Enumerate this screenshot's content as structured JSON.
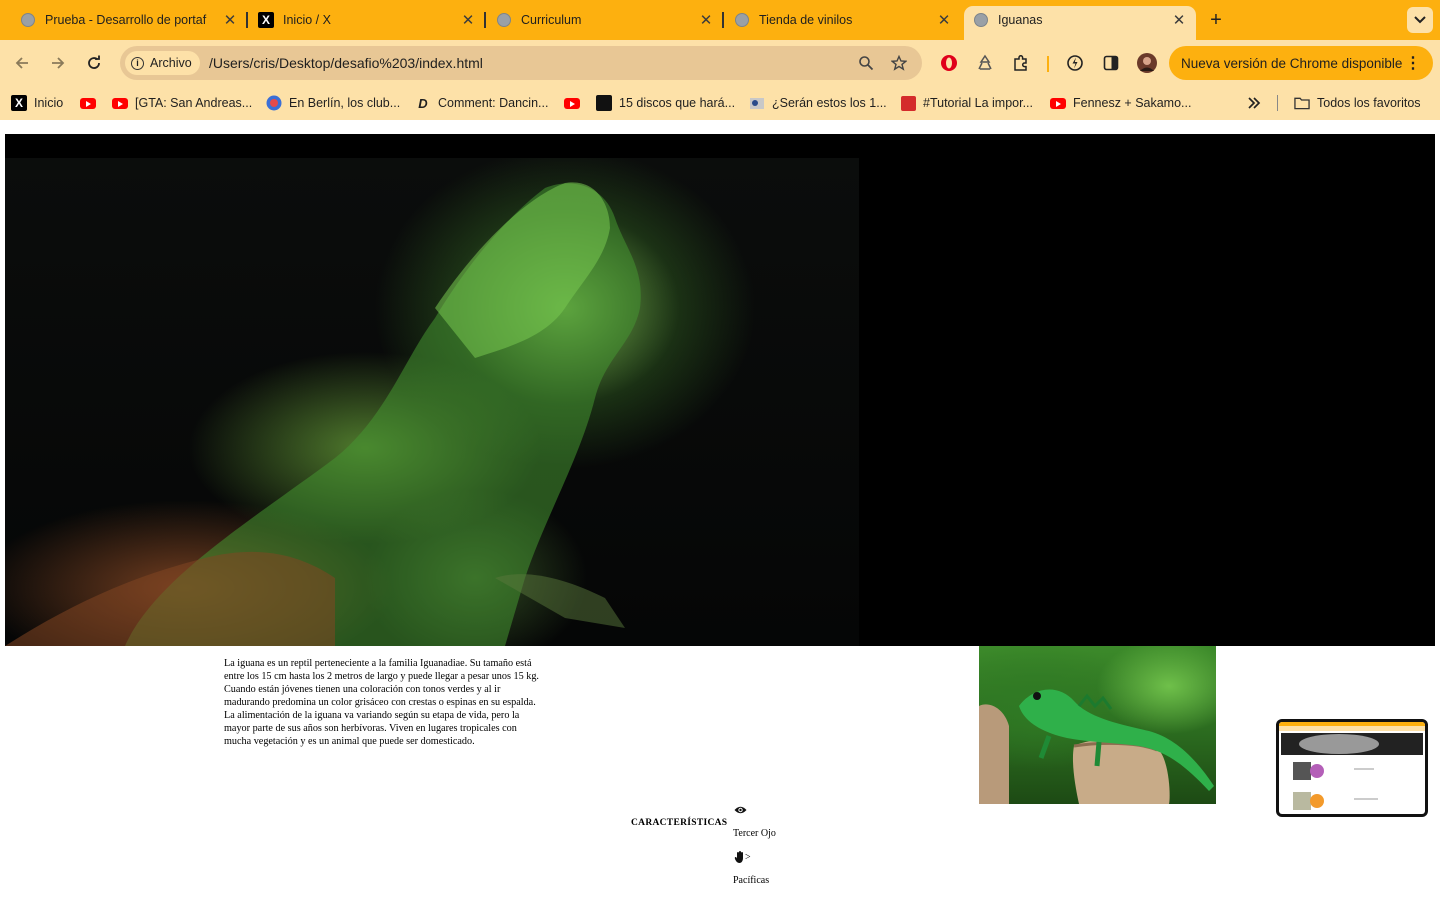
{
  "browser": {
    "tabs": [
      {
        "title": "Prueba - Desarrollo de portaf",
        "icon": "globe-icon",
        "active": false
      },
      {
        "title": "Inicio / X",
        "icon": "x-logo-icon",
        "active": false
      },
      {
        "title": "Curriculum",
        "icon": "globe-icon",
        "active": false
      },
      {
        "title": "Tienda de vinilos",
        "icon": "globe-icon",
        "active": false
      },
      {
        "title": "Iguanas",
        "icon": "globe-icon",
        "active": true
      }
    ],
    "omnibox": {
      "chip_label": "Archivo",
      "url": "/Users/cris/Desktop/desafio%203/index.html"
    },
    "update_button": "Nueva versión de Chrome disponible",
    "bookmarks": [
      {
        "label": "Inicio",
        "icon": "x-logo-icon"
      },
      {
        "label": "",
        "icon": "youtube-icon"
      },
      {
        "label": "[GTA: San Andreas...",
        "icon": "youtube-icon"
      },
      {
        "label": "En Berlín, los club...",
        "icon": "site-icon"
      },
      {
        "label": "Comment: Dancin...",
        "icon": "d-logo-icon"
      },
      {
        "label": "",
        "icon": "youtube-icon"
      },
      {
        "label": "15 discos que hará...",
        "icon": "site-icon"
      },
      {
        "label": "¿Serán estos los 1...",
        "icon": "site-icon"
      },
      {
        "label": "#Tutorial La impor...",
        "icon": "site-icon"
      },
      {
        "label": "Fennesz + Sakamo...",
        "icon": "youtube-icon"
      }
    ],
    "all_bookmarks": "Todos los favoritos"
  },
  "page": {
    "description": "La iguana es un reptil perteneciente a la familia Iguanadiae. Su tamaño está entre los 15 cm hasta los 2 metros de largo y puede llegar a pesar unos 15 kg. Cuando están jóvenes tienen una coloración con tonos verdes y al ir madurando predomina un color grisáceo con crestas o espinas en su espalda. La alimentación de la iguana va variando según su etapa de vida, pero la mayor parte de sus años son herbívoras. Viven en lugares tropicales con mucha vegetación y es un animal que puede ser domesticado.",
    "features_heading": "CARACTERÍSTICAS",
    "features": [
      {
        "icon": "eye-icon",
        "label": "Tercer Ojo"
      },
      {
        "icon": "hand-icon",
        "label": "Pacíficas",
        "icon_suffix": ">"
      }
    ]
  }
}
